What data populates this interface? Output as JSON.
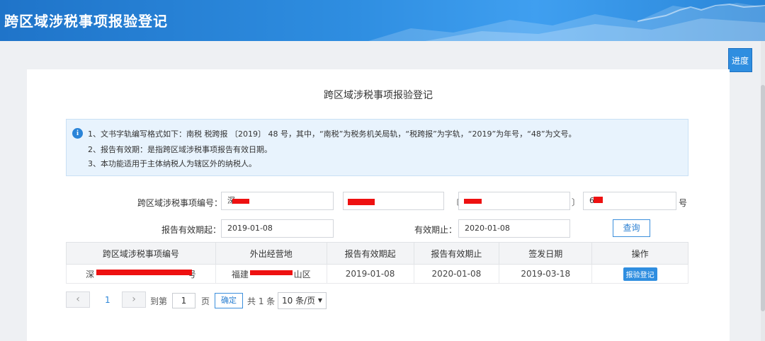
{
  "header": {
    "title": "跨区域涉税事项报验登记"
  },
  "progress_button": "进度",
  "card": {
    "title": "跨区域涉税事项报验登记",
    "notice": {
      "icon": "info-icon",
      "lines": [
        "1、文书字轨编写格式如下：南税 税跨报 〔2019〕 48 号，其中，“南税”为税务机关局轨，“税跨报”为字轨，“2019”为年号，“48”为文号。",
        "2、报告有效期：是指跨区域涉税事项报告有效日期。",
        "3、本功能适用于主体纳税人为辖区外的纳税人。"
      ]
    },
    "form": {
      "number_label": "跨区域涉税事项编号：",
      "number_fields": [
        "深",
        "",
        "",
        "6"
      ],
      "bracket_open": "〔",
      "bracket_close": "〕",
      "number_suffix": "号",
      "start_label": "报告有效期起：",
      "start_value": "2019-01-08",
      "end_label": "有效期止：",
      "end_value": "2020-01-08",
      "query_button": "查询"
    },
    "table": {
      "headers": [
        "跨区域涉税事项编号",
        "外出经营地",
        "报告有效期起",
        "报告有效期止",
        "签发日期",
        "操作"
      ],
      "rows": [
        {
          "number_visible_start": "深",
          "number_visible_end": "号",
          "place_visible_start": "福建",
          "place_visible_end": "山区",
          "start": "2019-01-08",
          "end": "2020-01-08",
          "issued": "2019-03-18",
          "action": "报验登记"
        }
      ]
    },
    "pagination": {
      "prev_icon": "chevron-left-icon",
      "next_icon": "chevron-right-icon",
      "current_page": "1",
      "goto_label": "到第",
      "page_input": "1",
      "page_unit": "页",
      "confirm": "确定",
      "total": "共 1 条",
      "page_size": "10 条/页"
    }
  }
}
